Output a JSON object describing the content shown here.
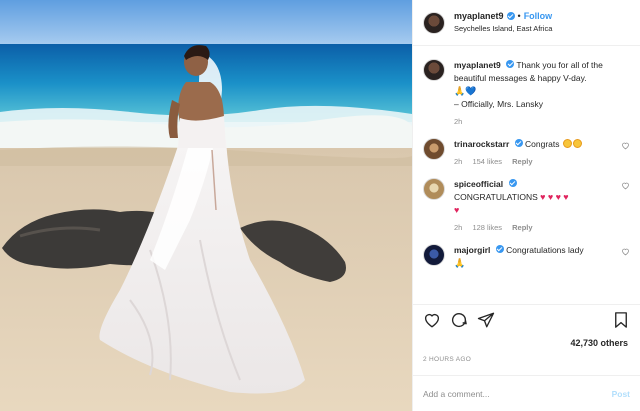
{
  "header": {
    "username": "myaplanet9",
    "separator": "•",
    "follow_label": "Follow",
    "location": "Seychelles Island, East Africa"
  },
  "caption": {
    "username": "myaplanet9",
    "text": "Thank you for all of the beautiful messages & happy V-day.",
    "signature": "– Officially, Mrs. Lansky",
    "time": "2h",
    "emoji": [
      "pray-emoji",
      "blue-heart-emoji"
    ]
  },
  "comments": [
    {
      "username": "trinarockstarr",
      "text": "Congrats",
      "emoji": [
        "heart-eyes-emoji",
        "grin-emoji"
      ],
      "time": "2h",
      "likes": "154 likes",
      "reply": "Reply"
    },
    {
      "username": "spiceofficial",
      "text": "CONGRATULATIONS",
      "emoji": [
        "red-heart-emoji",
        "red-heart-emoji",
        "red-heart-emoji",
        "red-heart-emoji",
        "red-heart-emoji"
      ],
      "time": "2h",
      "likes": "128 likes",
      "reply": "Reply"
    },
    {
      "username": "majorgirl",
      "text": "Congratulations lady",
      "emoji": [
        "pray-emoji"
      ]
    }
  ],
  "actions": {
    "icons": [
      "heart-icon",
      "comment-icon",
      "share-icon",
      "bookmark-icon"
    ]
  },
  "likes_count": "42,730 others",
  "time_ago": "2 HOURS AGO",
  "add_comment": {
    "placeholder": "Add a comment...",
    "post_label": "Post"
  },
  "colors": {
    "link_blue": "#3897f0",
    "muted": "#8e8e8e",
    "post_disabled": "#b2dffc"
  }
}
